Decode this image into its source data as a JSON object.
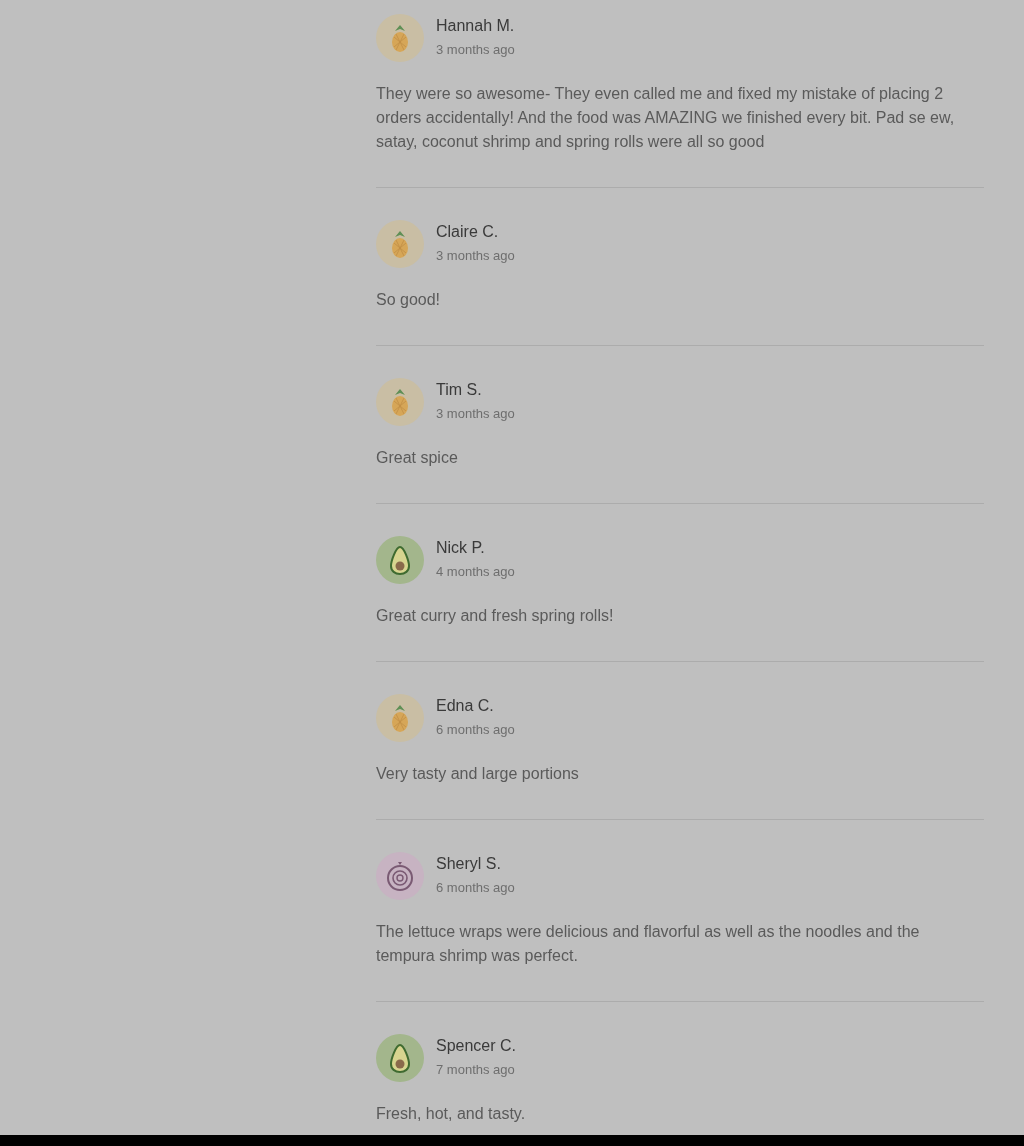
{
  "reviews": [
    {
      "name": "Hannah M.",
      "time": "3 months ago",
      "kind": "pineapple",
      "text": "They were so awesome- They even called me and fixed my mistake of placing 2 orders accidentally! And the food was AMAZING we finished every bit. Pad se ew, satay, coconut shrimp and spring rolls were all so good"
    },
    {
      "name": "Claire C.",
      "time": "3 months ago",
      "kind": "pineapple",
      "text": "So good!"
    },
    {
      "name": "Tim S.",
      "time": "3 months ago",
      "kind": "pineapple",
      "text": "Great spice"
    },
    {
      "name": "Nick P.",
      "time": "4 months ago",
      "kind": "avocado",
      "text": "Great curry and fresh spring rolls!"
    },
    {
      "name": "Edna C.",
      "time": "6 months ago",
      "kind": "pineapple",
      "text": "Very tasty and large portions"
    },
    {
      "name": "Sheryl S.",
      "time": "6 months ago",
      "kind": "onion",
      "text": "The lettuce wraps were delicious and flavorful as well as the noodles and the tempura shrimp was perfect."
    },
    {
      "name": "Spencer C.",
      "time": "7 months ago",
      "kind": "avocado",
      "text": "Fresh, hot, and tasty."
    }
  ]
}
